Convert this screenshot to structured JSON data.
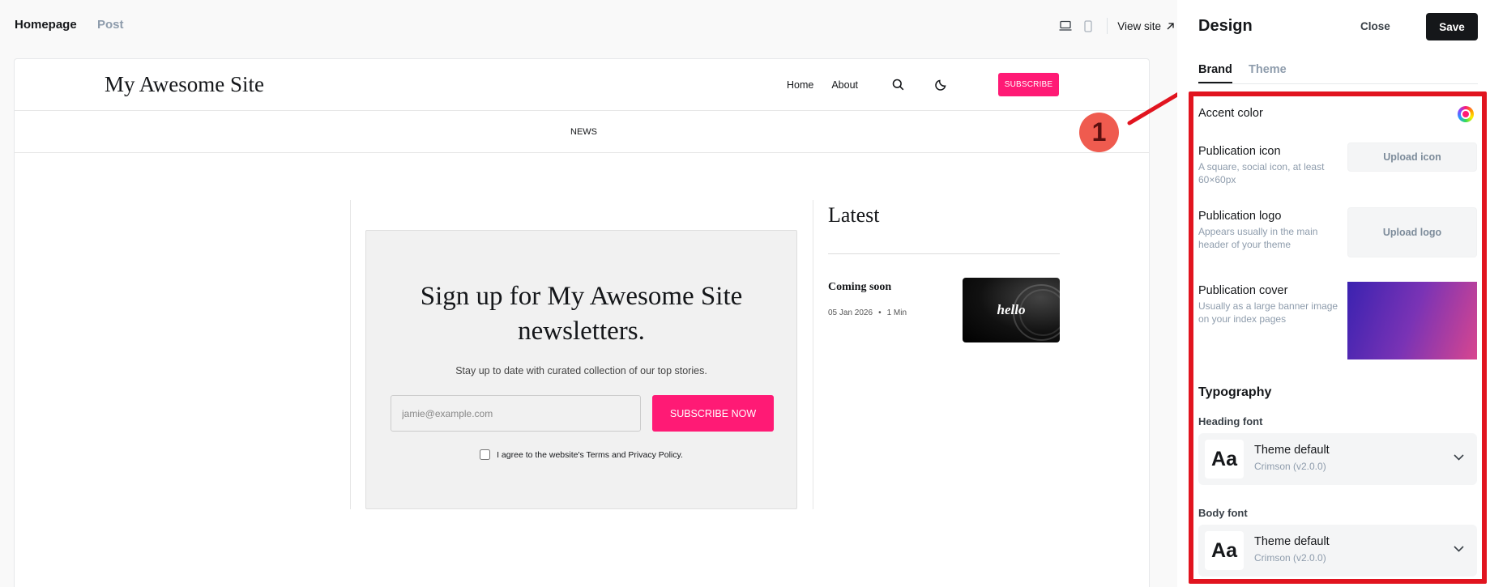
{
  "topbar": {
    "tabs": [
      "Homepage",
      "Post"
    ],
    "view_site": "View site"
  },
  "site": {
    "title": "My Awesome Site",
    "nav": [
      "Home",
      "About"
    ],
    "subscribe": "SUBSCRIBE",
    "secondary_nav": "NEWS",
    "signup": {
      "heading": "Sign up for My Awesome Site newsletters.",
      "subtext": "Stay up to date with curated collection of our top stories.",
      "email_placeholder": "jamie@example.com",
      "button": "SUBSCRIBE NOW",
      "agree": "I agree to the website's Terms and Privacy Policy."
    },
    "latest": {
      "heading": "Latest",
      "post_title": "Coming soon",
      "post_date": "05 Jan 2026",
      "post_sep": "•",
      "post_read": "1 Min",
      "thumb_text": "hello"
    }
  },
  "annotation": {
    "number": "1",
    "color": "#e1141f"
  },
  "panel": {
    "title": "Design",
    "close": "Close",
    "save": "Save",
    "tabs": [
      "Brand",
      "Theme"
    ],
    "accent": {
      "label": "Accent color",
      "color": "#ff1a75"
    },
    "icon": {
      "label": "Publication icon",
      "hint": "A square, social icon, at least 60×60px",
      "button": "Upload icon"
    },
    "logo": {
      "label": "Publication logo",
      "hint": "Appears usually in the main header of your theme",
      "button": "Upload logo"
    },
    "cover": {
      "label": "Publication cover",
      "hint": "Usually as a large banner image on your index pages"
    },
    "typography": {
      "heading": "Typography",
      "heading_font": {
        "label": "Heading font",
        "sample": "Aa",
        "name": "Theme default",
        "sub": "Crimson (v2.0.0)"
      },
      "body_font": {
        "label": "Body font",
        "sample": "Aa",
        "name": "Theme default",
        "sub": "Crimson (v2.0.0)"
      }
    }
  }
}
